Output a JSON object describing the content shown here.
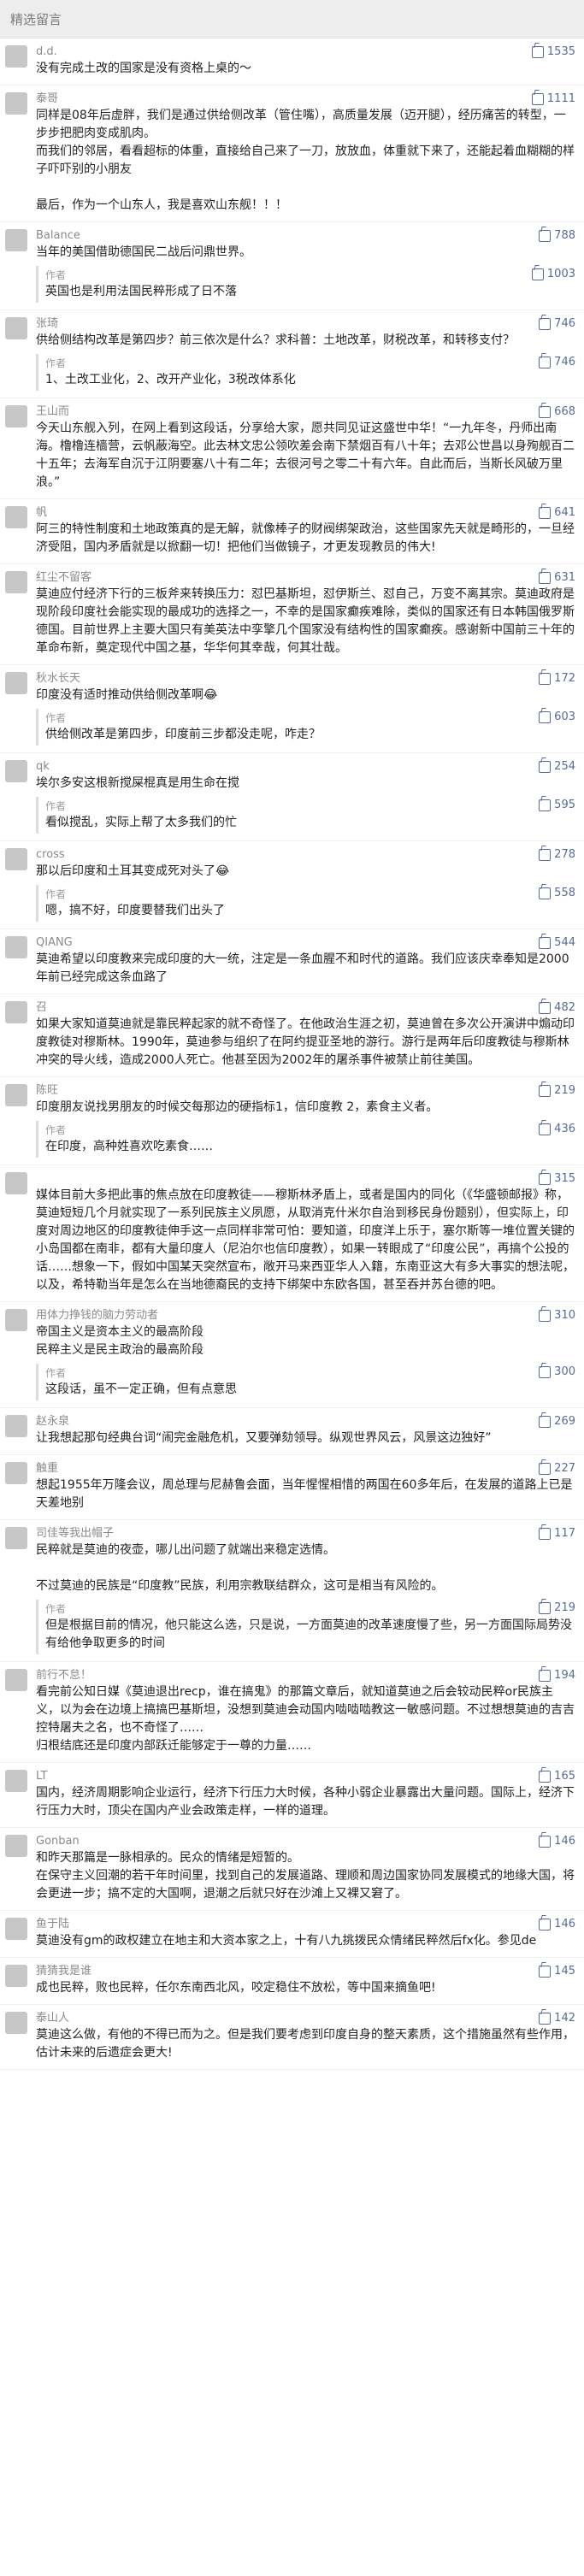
{
  "header": {
    "title": "精选留言"
  },
  "comments": [
    {
      "name": "d.d.",
      "likes": "1535",
      "text": "没有完成土改的国家是没有资格上桌的～",
      "reply": null
    },
    {
      "name": "泰哥",
      "likes": "1111",
      "text": "同样是08年后虚胖，我们是通过供给侧改革（管住嘴），高质量发展（迈开腿），经历痛苦的转型，一步步把肥肉变成肌肉。\n而我们的邻居，看看超标的体重，直接给自己来了一刀，放放血，体重就下来了，还能起着血糊糊的样子吓吓别的小朋友\n\n最后，作为一个山东人，我是喜欢山东舰！！！",
      "reply": null
    },
    {
      "name": "Balance",
      "likes": "788",
      "text": "当年的美国借助德国民二战后问鼎世界。",
      "reply": {
        "label": "作者",
        "likes": "1003",
        "text": "英国也是利用法国民粹形成了日不落"
      }
    },
    {
      "name": "张琦",
      "likes": "746",
      "text": "供给侧结构改革是第四步？前三依次是什么？求科普：土地改革，财税改革，和转移支付？",
      "reply": {
        "label": "作者",
        "likes": "746",
        "text": "1、土改工业化，2、改开产业化，3税改体系化"
      }
    },
    {
      "name": "王山而",
      "likes": "668",
      "text": "今天山东舰入列，在网上看到这段话，分享给大家，愿共同见证这盛世中华！“一九年冬，丹师出南海。橹橹连樯营，云帆蔽海空。此去林文忠公领吹差会南下禁烟百有八十年；去邓公世昌以身殉舰百二十五年；去海军自沉于江阴要塞八十有二年；去很河号之零二十有六年。自此而后，当斯长风破万里浪。”",
      "reply": null
    },
    {
      "name": "帆",
      "likes": "641",
      "text": "阿三的特性制度和土地政策真的是无解，就像棒子的财阀绑架政治，这些国家先天就是畸形的，一旦经济受阻，国内矛盾就是以掀翻一切！把他们当做镜子，才更发现教员的伟大!",
      "reply": null
    },
    {
      "name": "红尘不留客",
      "likes": "631",
      "text": "莫迪应付经济下行的三板斧来转换压力：怼巴基斯坦，怼伊斯兰、怼自己，万变不离其宗。莫迪政府是现阶段印度社会能实现的最成功的选择之一，不幸的是国家癫疾难除，类似的国家还有日本韩国俄罗斯德国。目前世界上主要大国只有美英法中孪擎几个国家没有结构性的国家癫疾。感谢新中国前三十年的革命布新，奠定现代中国之基，华华何其幸哉，何其壮哉。",
      "reply": null
    },
    {
      "name": "秋水长天",
      "likes": "172",
      "text": "印度没有适时推动供给侧改革啊😂",
      "reply": {
        "label": "作者",
        "likes": "603",
        "text": "供给侧改革是第四步，印度前三步都没走呢，咋走？"
      }
    },
    {
      "name": "qk",
      "likes": "254",
      "text": "埃尔多安这根新搅屎棍真是用生命在搅",
      "reply": {
        "label": "作者",
        "likes": "595",
        "text": "看似搅乱，实际上帮了太多我们的忙"
      }
    },
    {
      "name": "cross",
      "likes": "278",
      "text": "那以后印度和土耳其变成死对头了😂",
      "reply": {
        "label": "作者",
        "likes": "558",
        "text": "嗯，搞不好，印度要替我们出头了"
      }
    },
    {
      "name": "QIANG",
      "likes": "544",
      "text": "莫迪希望以印度教来完成印度的大一统，注定是一条血腥不和时代的道路。我们应该庆幸奉知是2000年前已经完成这条血路了",
      "reply": null
    },
    {
      "name": "召",
      "likes": "482",
      "text": "如果大家知道莫迪就是靠民粹起家的就不奇怪了。在他政治生涯之初，莫迪曾在多次公开演讲中煽动印度教徒对穆斯林。1990年，莫迪参与组织了在阿约提亚圣地的游行。游行是两年后印度教徒与穆斯林冲突的导火线，造成2000人死亡。他甚至因为2002年的屠杀事件被禁止前往美国。",
      "reply": null
    },
    {
      "name": "陈旺",
      "likes": "219",
      "text": "印度朋友说找男朋友的时候交每那边的硬指标1，信印度教 2，素食主义者。",
      "reply": {
        "label": "作者",
        "likes": "436",
        "text": "在印度，高种姓喜欢吃素食……"
      }
    },
    {
      "name": "",
      "likes": "315",
      "text": "媒体目前大多把此事的焦点放在印度教徒——穆斯林矛盾上，或者是国内的同化（《华盛顿邮报》称，莫迪短短几个月就实现了一系列民族主义夙愿，从取消克什米尔自治到移民身份题别），但实际上，印度对周边地区的印度教徒伸手这一点同样非常可怕：要知道，印度洋上乐于，塞尔斯等一堆位置关键的小岛国都在南非，都有大量印度人（尼泊尔也信印度教），如果一转眼成了“印度公民”，再搞个公投的话……想象一下，假如中国某天突然宣布，敞开马来西亚华人入籍，东南亚这大有多大事实的想法呢，以及，希特勒当年是怎么在当地德裔民的支持下绑架中东欧各国，甚至吞并苏台德的吧。",
      "reply": null
    },
    {
      "name": "用体力挣钱的脑力劳动者",
      "likes": "310",
      "text": "帝国主义是资本主义的最高阶段\n民粹主义是民主政治的最高阶段",
      "reply": {
        "label": "作者",
        "likes": "300",
        "text": "这段话，虽不一定正确，但有点意思"
      }
    },
    {
      "name": "赵永泉",
      "likes": "269",
      "text": "让我想起那句经典台词“闹完金融危机，又要弹劾领导。纵观世界风云，风景这边独好”",
      "reply": null
    },
    {
      "name": "触重",
      "likes": "227",
      "text": "想起1955年万隆会议，周总理与尼赫鲁会面，当年惺惺相惜的两国在60多年后，在发展的道路上已是天差地别",
      "reply": null
    },
    {
      "name": "司佳等我出帽子",
      "likes": "117",
      "text": "民粹就是莫迪的夜壶，哪儿出问题了就端出来稳定选情。\n\n不过莫迪的民族是“印度教”民族，利用宗教联结群众，这可是相当有风险的。",
      "reply": {
        "label": "作者",
        "likes": "219",
        "text": "但是根据目前的情况，他只能这么选，只是说，一方面莫迪的改革速度慢了些，另一方面国际局势没有给他争取更多的时间"
      }
    },
    {
      "name": "前行不怠！",
      "likes": "194",
      "text": "看完前公知日媒《莫迪退出recp，谁在搞鬼》的那篇文章后，就知道莫迪之后会较动民粹or民族主义，以为会在边境上搞搞巴基斯坦，没想到莫迪会动国内啮啮啮教这一敏感问题。不过想想莫迪的吉吉控特屠夫之名，也不奇怪了……\n归根结底还是印度内部跃迁能够定于一尊的力量……",
      "reply": null
    },
    {
      "name": "LT",
      "likes": "165",
      "text": "国内，经济周期影响企业运行，经济下行压力大时候，各种小弱企业暴露出大量问题。国际上，经济下行压力大时，顶尖在国内产业会政策走样，一样的道理。",
      "reply": null
    },
    {
      "name": "Gonban",
      "likes": "146",
      "text": "和昨天那篇是一脉相承的。民众的情绪是短暂的。\n在保守主义回潮的若干年时间里，找到自己的发展道路、理顺和周边国家协同发展模式的地缘大国，将会更进一步；搞不定的大国啊，退潮之后就只好在沙滩上又裸又窘了。",
      "reply": null
    },
    {
      "name": "鱼于陆",
      "likes": "146",
      "text": "莫迪没有gm的政权建立在地主和大资本家之上，十有八九挑拨民众情绪民粹然后fx化。参见de",
      "reply": null
    },
    {
      "name": "猜猜我是谁",
      "likes": "145",
      "text": "成也民粹，败也民粹，任尔东南西北风，咬定稳住不放松，等中国来摘鱼吧!",
      "reply": null
    },
    {
      "name": "泰山人",
      "likes": "142",
      "text": "莫迪这么做，有他的不得已而为之。但是我们要考虑到印度自身的整天素质，这个措施虽然有些作用，估计未来的后遗症会更大!",
      "reply": null
    }
  ]
}
